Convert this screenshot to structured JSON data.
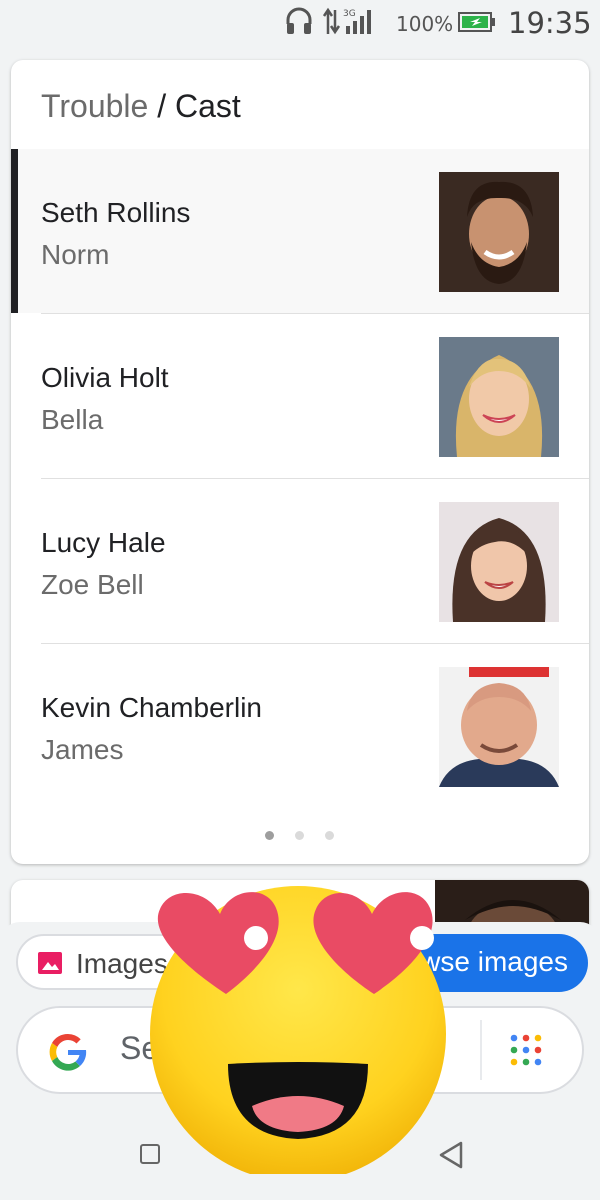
{
  "status_bar": {
    "network": "3G",
    "battery_percent": "100%",
    "time": "19:35"
  },
  "breadcrumb": {
    "parent": "Trouble",
    "separator": " / ",
    "current": "Cast"
  },
  "cast": [
    {
      "name": "Seth Rollins",
      "role": "Norm",
      "selected": true
    },
    {
      "name": "Olivia Holt",
      "role": "Bella",
      "selected": false
    },
    {
      "name": "Lucy Hale",
      "role": "Zoe Bell",
      "selected": false
    },
    {
      "name": "Kevin Chamberlin",
      "role": "James",
      "selected": false
    }
  ],
  "pagination": {
    "pages": 3,
    "current": 1
  },
  "bottom_sheet": {
    "images_chip_label": "Images",
    "browse_chip_label": "Browse images",
    "search_placeholder": "Search"
  },
  "colors": {
    "accent": "#1a73e8",
    "selected_bar": "#202124",
    "emoji_face": "#ffd21f",
    "emoji_heart": "#e94b64"
  },
  "icons": {
    "images_chip": "image-icon",
    "search_logo": "google-g-icon",
    "apps": "apps-grid-icon",
    "nav_recents": "square-icon",
    "nav_back": "back-triangle-icon",
    "overlay": "heart-eyes-emoji"
  }
}
